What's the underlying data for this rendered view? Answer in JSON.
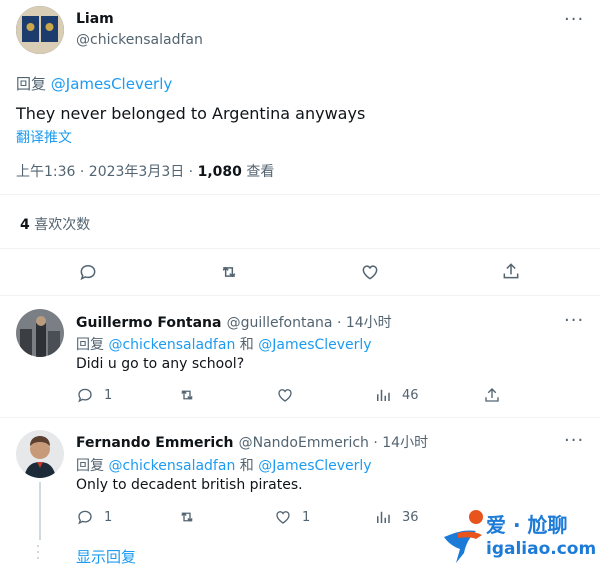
{
  "main_tweet": {
    "author_name": "Liam",
    "author_handle": "@chickensaladfan",
    "reply_prefix": "回复",
    "reply_to": "@JamesCleverly",
    "text": "They never belonged to Argentina anyways",
    "translate_label": "翻译推文",
    "timestamp": "上午1:36 · 2023年3月3日 · ",
    "views_count": "1,080",
    "views_label": " 查看",
    "likes_count": "4",
    "likes_label": " 喜欢次数"
  },
  "replies": [
    {
      "author_name": "Guillermo Fontana",
      "author_handle": "@guillefontana",
      "time": " · 14小时",
      "reply_prefix": "回复",
      "reply_to_1": "@chickensaladfan",
      "and": " 和 ",
      "reply_to_2": "@JamesCleverly",
      "text": "Didi u go to any school?",
      "reply_count": "1",
      "retweet_count": "",
      "like_count": "",
      "views_count": "46"
    },
    {
      "author_name": "Fernando Emmerich",
      "author_handle": "@NandoEmmerich",
      "time": " · 14小时",
      "reply_prefix": "回复",
      "reply_to_1": "@chickensaladfan",
      "and": " 和 ",
      "reply_to_2": "@JamesCleverly",
      "text": "Only to decadent british pirates.",
      "reply_count": "1",
      "retweet_count": "",
      "like_count": "1",
      "views_count": "36"
    }
  ],
  "show_replies_label": "显示回复",
  "watermark": {
    "text_top": "爱 · 尬聊",
    "text_bottom": "igaliao.com"
  },
  "colors": {
    "link": "#1d9bf0",
    "muted": "#536471",
    "text": "#0f1419",
    "border": "#eff3f4"
  }
}
